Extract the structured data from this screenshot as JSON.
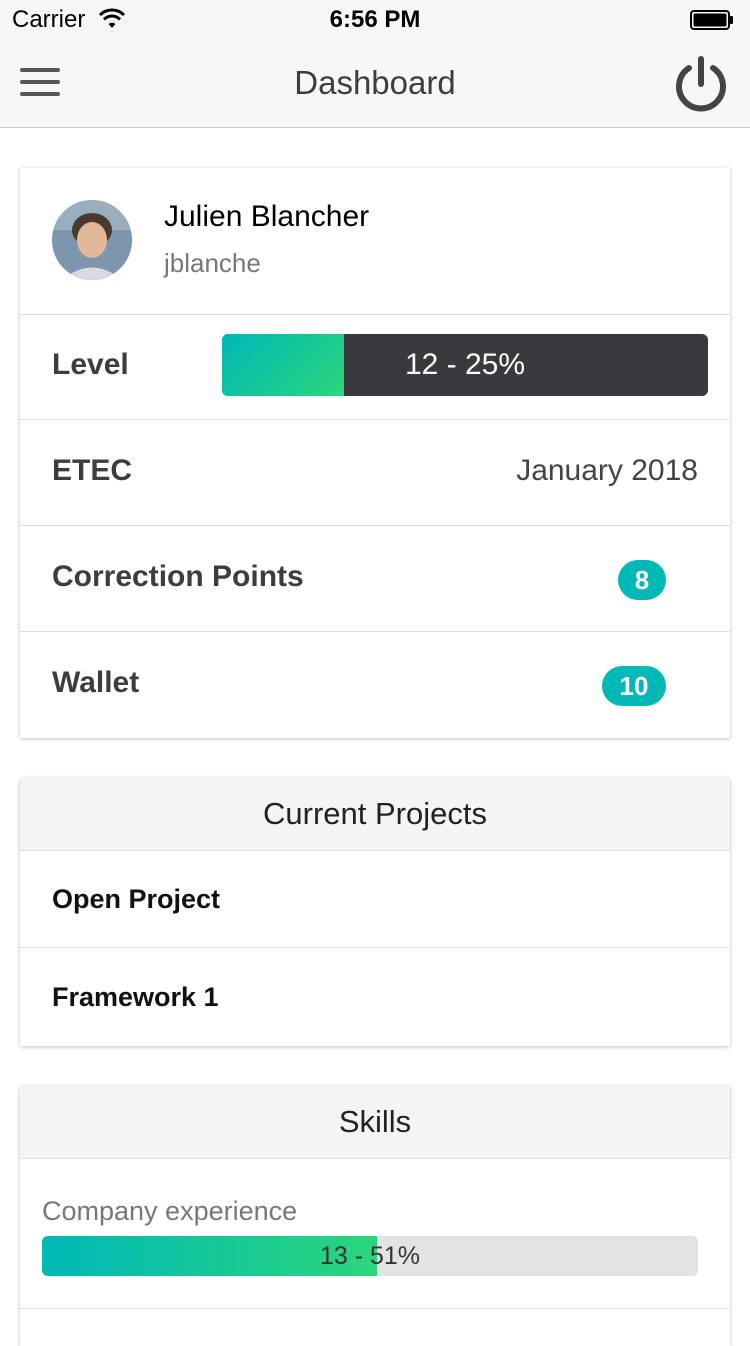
{
  "status_bar": {
    "carrier": "Carrier",
    "time": "6:56 PM"
  },
  "nav": {
    "title": "Dashboard",
    "menu_icon": "hamburger-menu-icon",
    "power_icon": "power-icon"
  },
  "profile": {
    "full_name": "Julien Blancher",
    "login": "jblanche",
    "level_label": "Level",
    "level_text": "12 - 25%",
    "level_progress": 0.25,
    "campus_label": "ETEC",
    "campus_value": "January 2018",
    "correction_label": "Correction Points",
    "correction_points": "8",
    "wallet_label": "Wallet",
    "wallet_value": "10"
  },
  "projects": {
    "title": "Current Projects",
    "items": [
      {
        "name": "Open Project"
      },
      {
        "name": "Framework 1"
      }
    ]
  },
  "skills": {
    "title": "Skills",
    "items": [
      {
        "name": "Company experience",
        "text": "13 - 51%",
        "progress": 0.51
      }
    ]
  },
  "colors": {
    "accent": "#00b9b7",
    "progress_gradient_start": "#00b8b8",
    "progress_gradient_end": "#2bd67b",
    "level_bar_bg": "#3a3a3e"
  }
}
